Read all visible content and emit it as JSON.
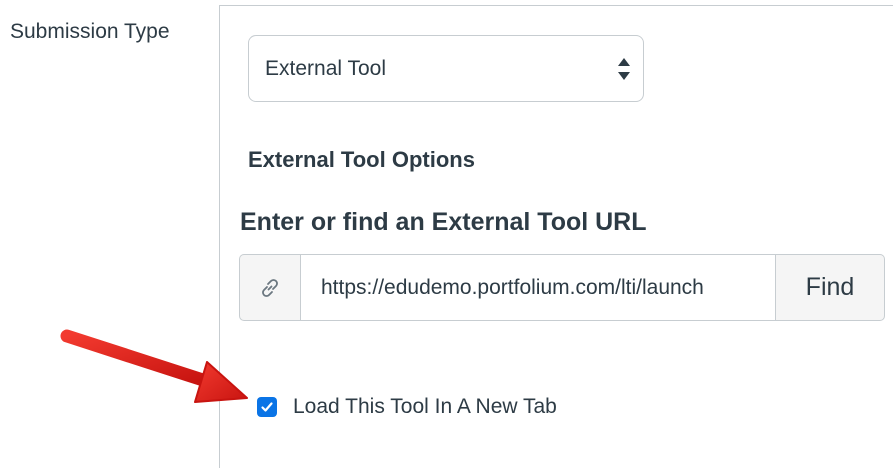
{
  "submission_type": {
    "label": "Submission Type",
    "selected": "External Tool"
  },
  "external_tool": {
    "options_heading": "External Tool Options",
    "url_heading": "Enter or find an External Tool URL",
    "url_value": "https://edudemo.portfolium.com/lti/launch",
    "link_icon": "link-icon",
    "find_label": "Find"
  },
  "new_tab": {
    "label": "Load This Tool In A New Tab",
    "checked": true
  },
  "colors": {
    "checkbox": "#0a74e6",
    "annotation_arrow": "#e0201c",
    "text": "#2d3b45"
  }
}
